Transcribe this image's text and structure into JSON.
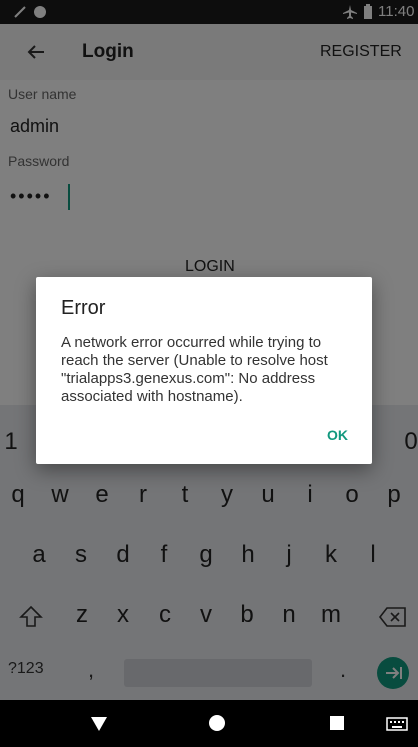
{
  "status_bar": {
    "time": "11:40",
    "left_icons": [
      "edit-icon",
      "circle-icon"
    ],
    "right_icons": [
      "airplane-icon",
      "battery-icon"
    ]
  },
  "toolbar": {
    "back_icon": "back-arrow-icon",
    "title": "Login",
    "register_label": "REGISTER"
  },
  "form": {
    "username_label": "User name",
    "username_value": "admin",
    "password_label": "Password",
    "password_value": "•••••",
    "login_label": "LOGIN"
  },
  "keyboard": {
    "number_row_left": "1",
    "number_row_right": "0",
    "row1": [
      "q",
      "w",
      "e",
      "r",
      "t",
      "y",
      "u",
      "i",
      "o",
      "p"
    ],
    "row2": [
      "a",
      "s",
      "d",
      "f",
      "g",
      "h",
      "j",
      "k",
      "l"
    ],
    "row3": [
      "z",
      "x",
      "c",
      "v",
      "b",
      "n",
      "m"
    ],
    "shift_icon": "shift-icon",
    "backspace_icon": "backspace-icon",
    "symbols_label": "?123",
    "comma_label": ",",
    "period_label": ".",
    "enter_icon": "next-arrow-icon",
    "accent": "#11987e"
  },
  "dialog": {
    "title": "Error",
    "message": "A network error occurred while trying to reach the server (Unable to resolve host \"trialapps3.genexus.com\": No address associated with hostname).",
    "ok_label": "OK"
  },
  "nav_bar": {
    "icons": [
      "back-triangle-icon",
      "home-circle-icon",
      "recents-square-icon",
      "keyboard-icon"
    ]
  }
}
